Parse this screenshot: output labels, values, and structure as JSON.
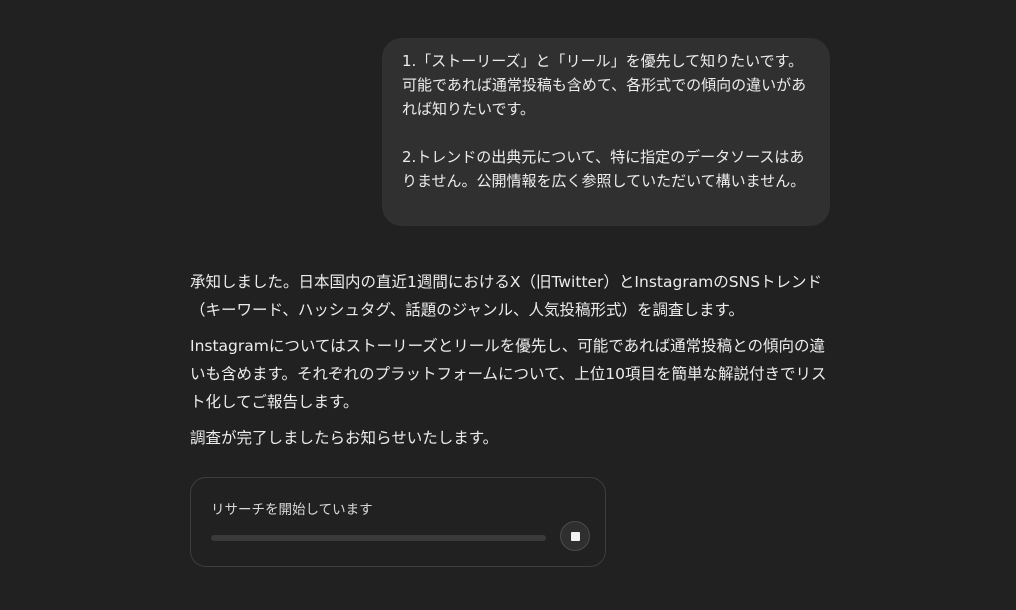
{
  "user_message": {
    "paragraph_1": "1.「ストーリーズ」と「リール」を優先して知りたいです。可能であれば通常投稿も含めて、各形式での傾向の違いがあれば知りたいです。",
    "paragraph_2": "2.トレンドの出典元について、特に指定のデータソースはありません。公開情報を広く参照していただいて構いません。"
  },
  "assistant_message": {
    "paragraphs": [
      "承知しました。日本国内の直近1週間におけるX（旧Twitter）とInstagramのSNSトレンド（キーワード、ハッシュタグ、話題のジャンル、人気投稿形式）を調査します。",
      "Instagramについてはストーリーズとリールを優先し、可能であれば通常投稿との傾向の違いも含めます。それぞれのプラットフォームについて、上位10項目を簡単な解説付きでリスト化してご報告します。",
      "調査が完了しましたらお知らせいたします。"
    ]
  },
  "research_card": {
    "status_text": "リサーチを開始しています",
    "progress": 0,
    "stop_icon": "stop-icon"
  }
}
